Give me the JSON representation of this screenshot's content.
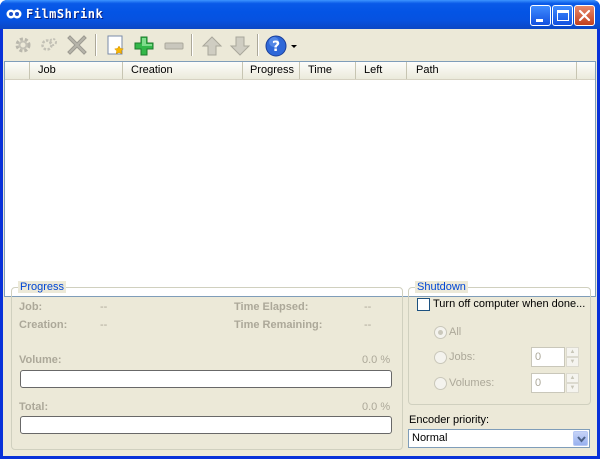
{
  "window": {
    "title": "FilmShrink",
    "title_bar_color": "#0454e5",
    "close_button_color": "#c2401e"
  },
  "toolbar": {
    "icons": [
      "settings-gear-icon",
      "tools-icon",
      "delete-x-icon",
      "new-job-icon",
      "add-plus-icon",
      "remove-minus-icon",
      "move-up-icon",
      "move-down-icon",
      "help-icon",
      "dropdown-arrow-icon"
    ]
  },
  "job_list": {
    "columns": [
      "Job",
      "Creation",
      "Progress",
      "Time",
      "Left",
      "Path"
    ],
    "rows": []
  },
  "progress": {
    "group_title": "Progress",
    "job_label": "Job:",
    "job_value": "--",
    "creation_label": "Creation:",
    "creation_value": "--",
    "time_elapsed_label": "Time Elapsed:",
    "time_elapsed_value": "--",
    "time_remaining_label": "Time Remaining:",
    "time_remaining_value": "--",
    "volume_label": "Volume:",
    "volume_percent": "0.0 %",
    "volume_fraction": 0.0,
    "total_label": "Total:",
    "total_percent": "0.0 %",
    "total_fraction": 0.0
  },
  "shutdown": {
    "group_title": "Shutdown",
    "turn_off_label": "Turn off computer when done...",
    "turn_off_checked": false,
    "all_label": "All",
    "all_selected": true,
    "jobs_label": "Jobs:",
    "jobs_value": "0",
    "volumes_label": "Volumes:",
    "volumes_value": "0"
  },
  "encoder": {
    "label": "Encoder priority:",
    "selected": "Normal"
  }
}
